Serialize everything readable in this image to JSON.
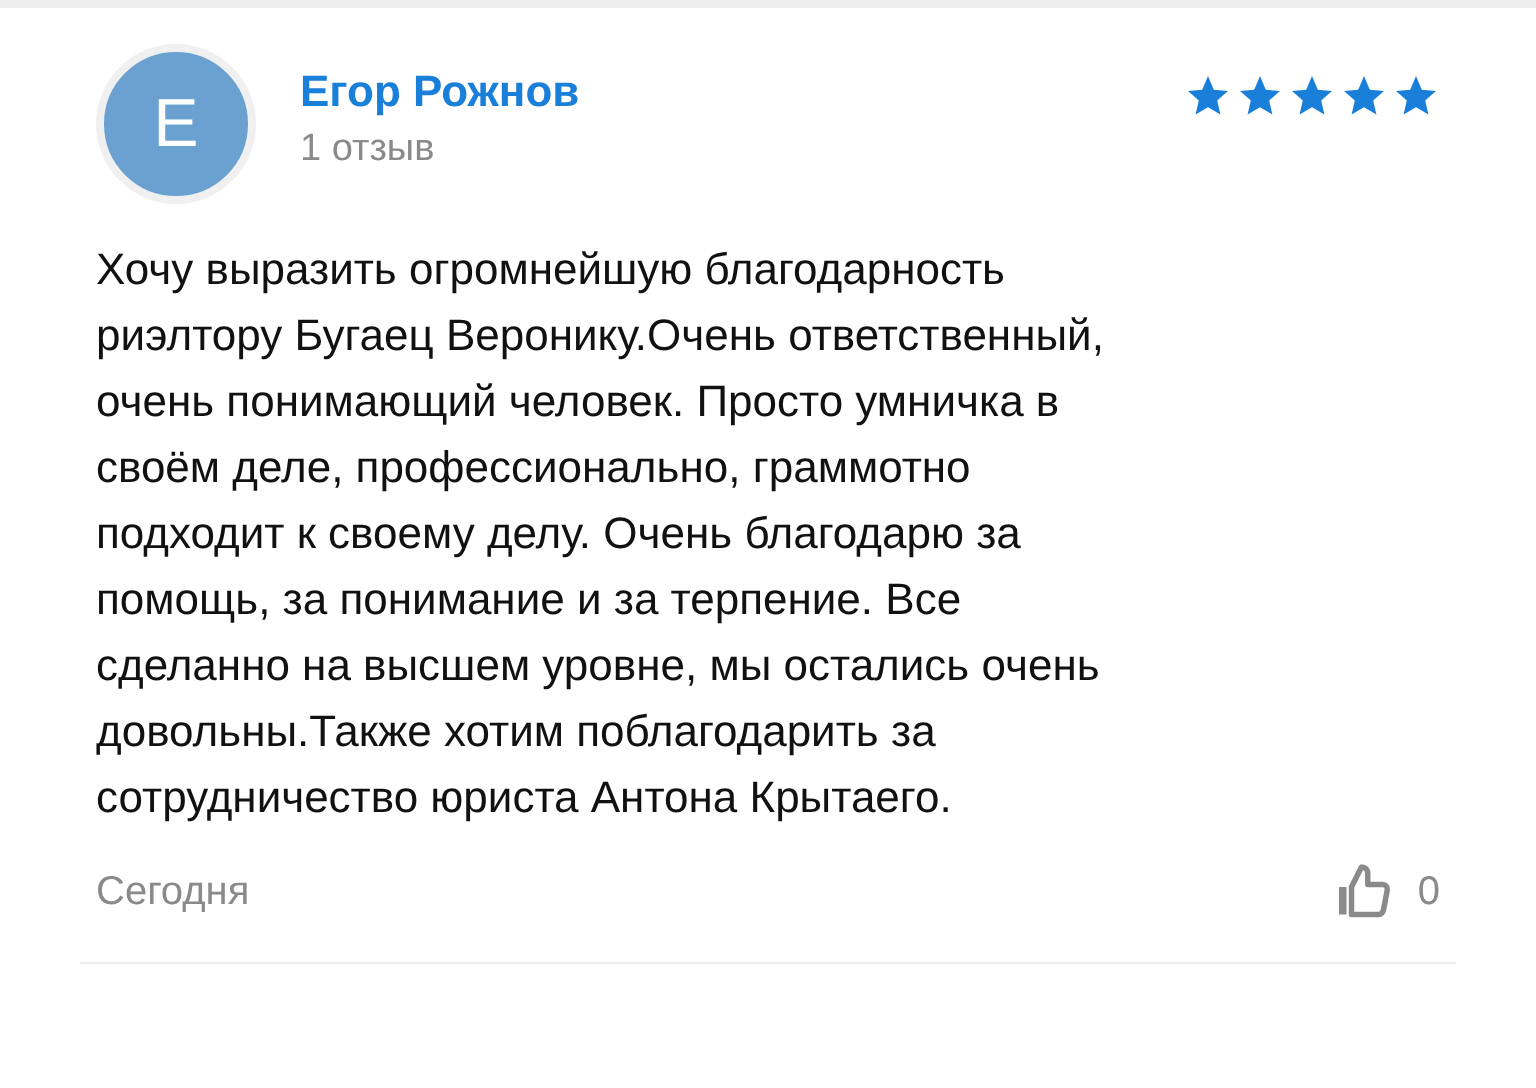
{
  "review": {
    "avatar_letter": "E",
    "author": "Егор Рожнов",
    "author_meta": "1 отзыв",
    "stars": 5,
    "text": "Хочу выразить огромнейшую благодарность\nриэлтору Бугаец Веронику.Очень ответственный,\nочень понимающий человек. Просто умничка в\nсвоём деле, профессионально, граммотно\nподходит к своему делу. Очень благодарю за\nпомощь, за понимание и за терпение. Все\nсделанно на высшем уровне, мы остались очень\nдовольны.Также хотим поблагодарить за\nсотрудничество юриста Антона Крытаего.",
    "date": "Сегодня",
    "likes": "0"
  }
}
